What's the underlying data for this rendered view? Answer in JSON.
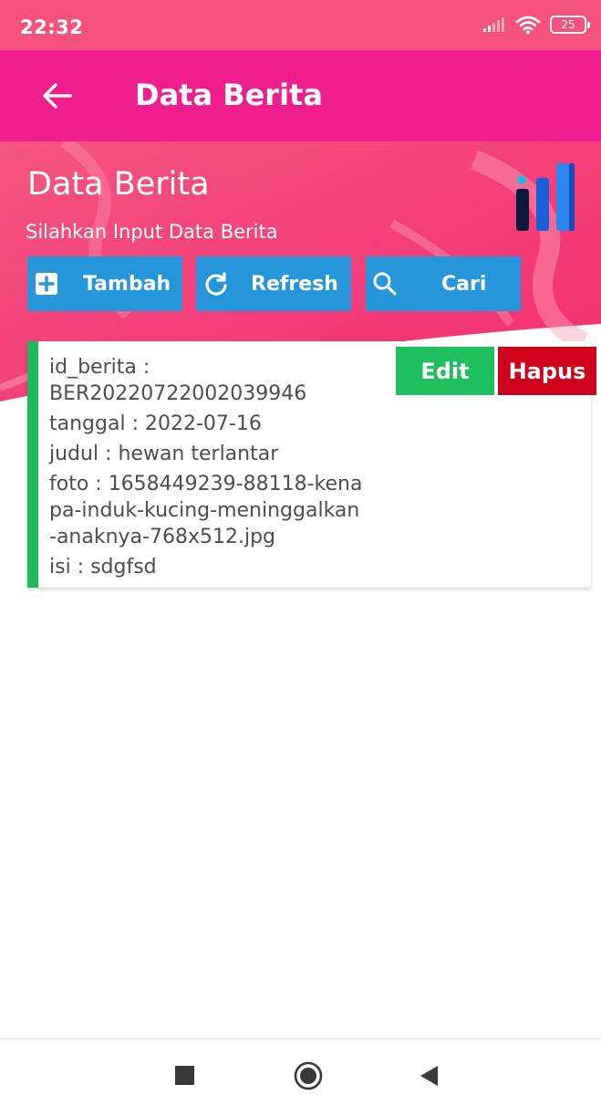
{
  "status_bar": {
    "time": "22:32",
    "battery": "25"
  },
  "app_bar": {
    "title": "Data Berita"
  },
  "header": {
    "title": "Data Berita",
    "subtitle": "Silahkan Input Data Berita"
  },
  "buttons": {
    "add": "Tambah",
    "refresh": "Refresh",
    "search": "Cari"
  },
  "card": {
    "line_id_label": "id_berita :",
    "line_id_value": "BER20220722002039946",
    "line_date": "tanggal : 2022-07-16",
    "line_title": "judul : hewan terlantar",
    "line_photo_1": "foto : 1658449239-88118-kena",
    "line_photo_2": "pa-induk-kucing-meninggalkan",
    "line_photo_3": "-anaknya-768x512.jpg",
    "line_content": "isi : sdgfsd",
    "edit_label": "Edit",
    "delete_label": "Hapus"
  },
  "colors": {
    "status_bar": "#f6527e",
    "app_bar": "#ef1d8d",
    "button_blue": "#2596d9",
    "card_accent": "#1fb85a",
    "edit": "#1ec05d",
    "delete": "#d0021b"
  },
  "icons": {
    "back": "arrow-left-icon",
    "add": "plus-square-icon",
    "refresh": "refresh-icon",
    "search": "search-icon",
    "logo": "bar-chart-logo-icon"
  }
}
